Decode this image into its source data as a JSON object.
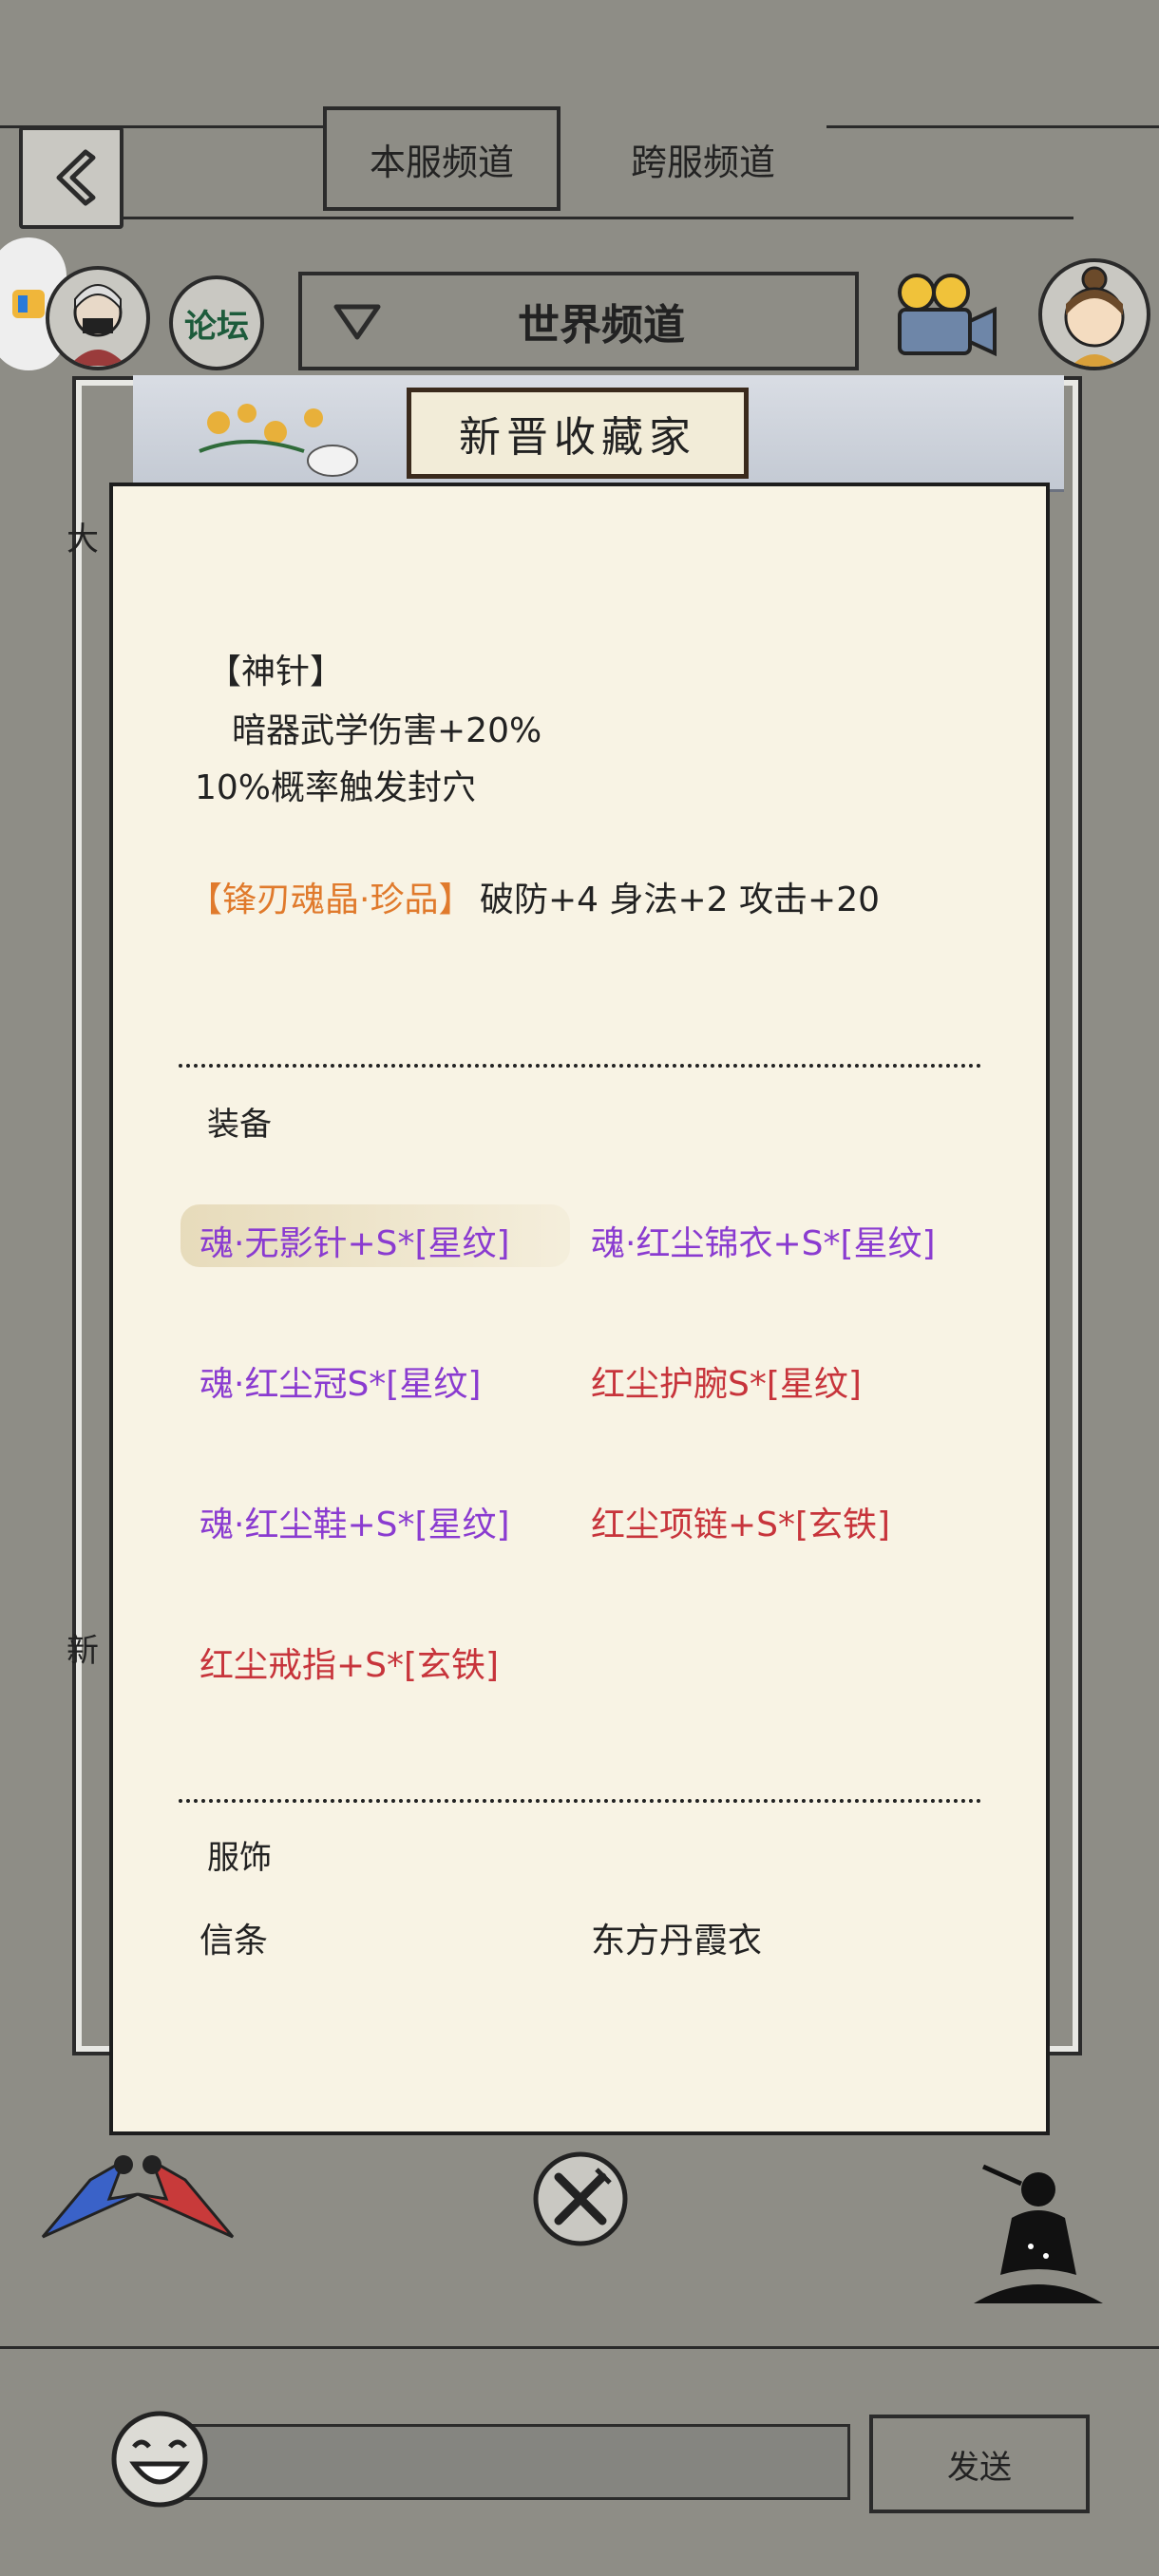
{
  "tabs": {
    "local": "本服频道",
    "cross": "跨服频道"
  },
  "header": {
    "forum": "论坛",
    "channel": "世界频道"
  },
  "frame": {
    "title": "新晋收藏家"
  },
  "effect": {
    "name": "【神针】",
    "line1": "暗器武学伤害+20%",
    "line2": "10%概率触发封穴"
  },
  "gem": {
    "name": "【锋刃魂晶·珍品】",
    "stats": "破防+4 身法+2 攻击+20"
  },
  "equipment": {
    "heading": "装备",
    "items": [
      {
        "name": "魂·无影针+S*[星纹]",
        "color": "purple"
      },
      {
        "name": "魂·红尘锦衣+S*[星纹]",
        "color": "purple"
      },
      {
        "name": "魂·红尘冠S*[星纹]",
        "color": "purple"
      },
      {
        "name": "红尘护腕S*[星纹]",
        "color": "red"
      },
      {
        "name": "魂·红尘鞋+S*[星纹]",
        "color": "purple"
      },
      {
        "name": "红尘项链+S*[玄铁]",
        "color": "red"
      },
      {
        "name": "红尘戒指+S*[玄铁]",
        "color": "red"
      }
    ]
  },
  "costume": {
    "heading": "服饰",
    "items": [
      "信条",
      "东方丹霞衣"
    ]
  },
  "chat": {
    "input_value": "",
    "send": "发送"
  },
  "colors": {
    "purple": "#8a3bd0",
    "red": "#c7343b",
    "orange": "#e07a2c",
    "panel": "#f8f3e4",
    "background": "#8e8d86"
  }
}
